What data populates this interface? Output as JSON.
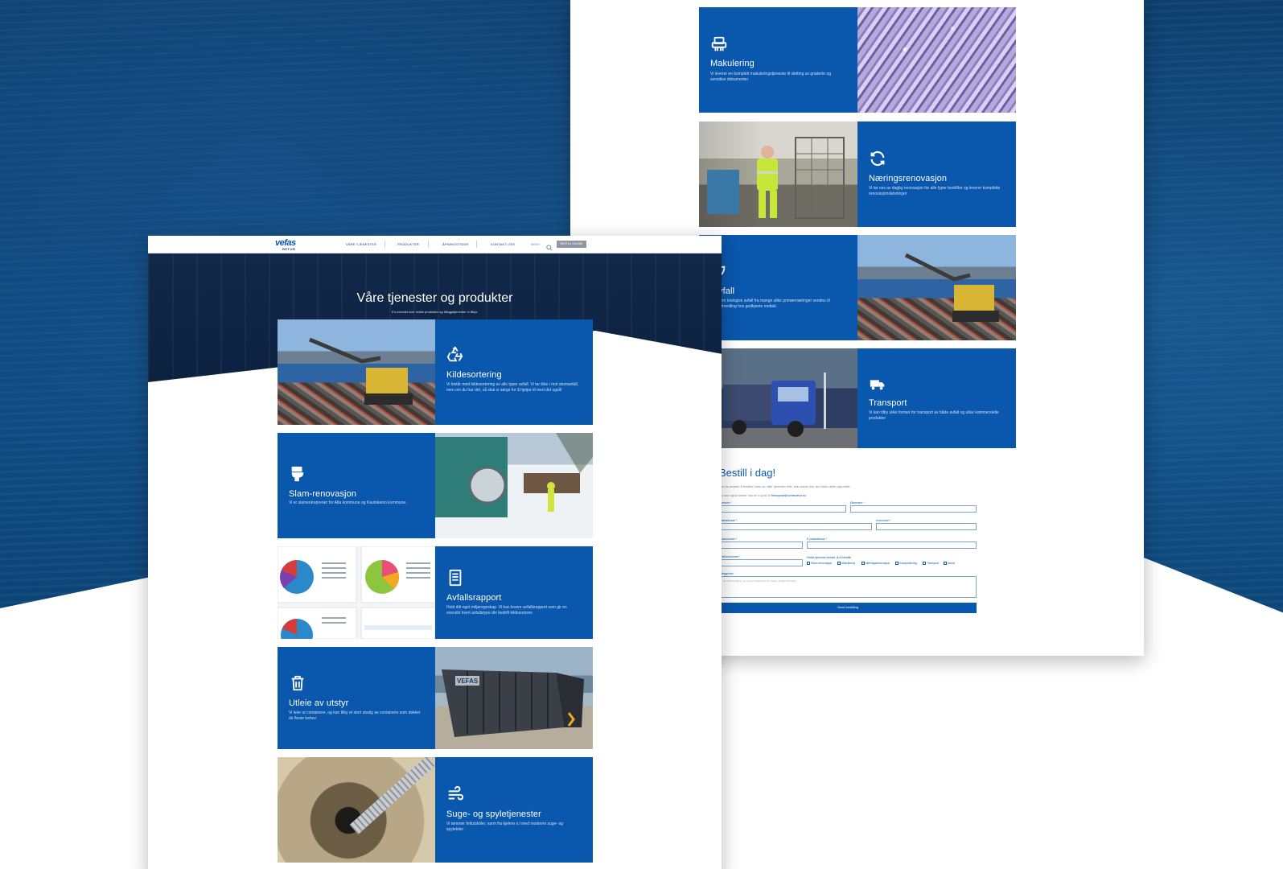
{
  "left_page": {
    "nav": {
      "logo_main": "vefas",
      "logo_sub": "RETUR",
      "links": [
        "VÅRE TJENESTER",
        "PRODUKTER",
        "ÅPNINGSTIDER",
        "KONTAKT OSS"
      ],
      "menu": "MENY",
      "cta": "BESTILL ONLINE"
    },
    "hero": {
      "title": "Våre tjenester og produkter",
      "subtitle": "En oversikt over hvilke produkter og tilleggstjenester vi tilbyr."
    },
    "tiles": [
      {
        "title": "Kildesortering",
        "desc": "Vi bistår med kildesortering av alle typer avfall. Vi tar ikke i mot atomavfall, men om du har det, så skal vi sørge for å hjelpe til med det også!",
        "icon": "recycle-icon"
      },
      {
        "title": "Slam-renovasjon",
        "desc": "Vi er slamentreprenør for Alta kommune og Kautokeino kommune.",
        "icon": "toilet-icon"
      },
      {
        "title": "Avfallsrapport",
        "desc": "Hold ditt eget miljøregnskap. Vi kan levere avfallsrapport som gir en oversikt hvert avfallstype din bedrift kildesorterer",
        "icon": "document-icon"
      },
      {
        "title": "Utleie av utstyr",
        "desc": "Vi leier ut containere, og kan tilby et stort utvalg av containere som dekker de fleste behov.",
        "icon": "trash-icon"
      },
      {
        "title": "Suge- og spyletjenester",
        "desc": "Vi tømmer fettutskiller, varm fra kjelere o.l med moderne suge- og spylebiler",
        "icon": "wind-icon"
      }
    ],
    "container_text": "VEFAS"
  },
  "right_page": {
    "tiles": [
      {
        "title": "Makulering",
        "desc": "Vi leverer en komplett makuleringstjeneste til sletting av graderte og sensitive dokumenter",
        "icon": "shredder-icon"
      },
      {
        "title": "Næringsrenovasjon",
        "desc": "Vi tar oss av daglig renovasjon for alle typer bedrifter og leverer komplette renovasjonsløsninger",
        "icon": "refresh-icon"
      },
      {
        "title": "-avfall",
        "desc": "hånd om biologisk avfall fra mange ulike primærnæringer sendes til videreforedling hos godkjente mottak.",
        "icon": "leaf-icon"
      },
      {
        "title": "Transport",
        "desc": "Vi kan tilby ulike former for transport av både avfall og ulike kommersielle produkter",
        "icon": "truck-icon"
      }
    ],
    "form": {
      "title": "Bestill i dag!",
      "intro": "Om du ønsker å bestille noen av våre tjenester eller lete-saken kan du bruke dette skjemaet.",
      "intro2_prefix": "Du kan også sende oss en e-post til ",
      "intro2_link": "firmapost@vefasretur.no",
      "fields": {
        "firstname": "Fornavn *",
        "lastname": "Etternavn *",
        "address": "Gateadresse *",
        "municipality": "Kommune *",
        "postcode": "Postnummer *",
        "email": "E-postadresse *",
        "phone": "Telefonnummer *",
        "services": "Hvilke tjenester ønsker du å bestille",
        "comment": "Tilleggsinfo"
      },
      "checkboxes": [
        "Slam-renovasjon",
        "Makulering",
        "Næringsrenovasjon",
        "Kompostering",
        "Transport",
        "Annet"
      ],
      "comment_placeholder": "Her kan du skrive inn en kort beskrivelse av hva du ønsker å bestille",
      "submit": "Send bestilling"
    }
  },
  "colors": {
    "brand_blue": "#0a57ae",
    "navy": "#0b3b6a",
    "hero": "#13294a"
  }
}
